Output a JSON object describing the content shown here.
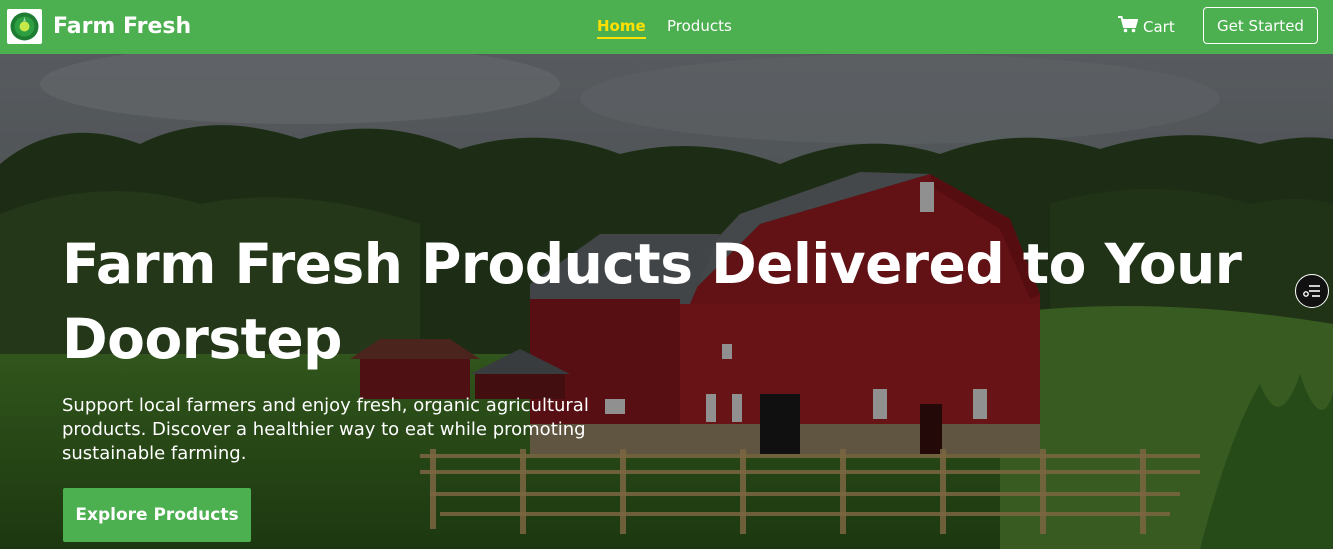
{
  "nav": {
    "brand": "Farm Fresh",
    "links": [
      {
        "label": "Home",
        "active": true
      },
      {
        "label": "Products",
        "active": false
      }
    ],
    "cart_label": "Cart",
    "cta_label": "Get Started",
    "brand_color": "#4caf50",
    "active_color": "#ffe000"
  },
  "hero": {
    "title": "Farm Fresh Products Delivered to Your Doorstep",
    "subtitle": "Support local farmers and enjoy fresh, organic agricultural products. Discover a healthier way to eat while promoting sustainable farming.",
    "button_label": "Explore Products"
  },
  "icons": {
    "logo": "farm-logo-icon",
    "cart": "shopping-cart-icon",
    "floating": "filter-list-icon"
  }
}
